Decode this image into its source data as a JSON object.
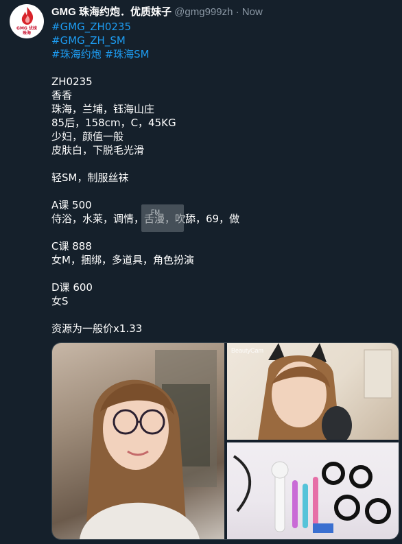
{
  "tweet": {
    "display_name": "GMG 珠海约炮．优质妹子",
    "handle": "@gmg999zh",
    "separator": "·",
    "time": "Now",
    "avatar_text_line1": "GMG 优妹",
    "avatar_text_line2": "珠海",
    "hashtags_line1": "#GMG_ZH0235",
    "hashtags_line2": "#GMG_ZH_SM",
    "hashtags_line3": [
      "#珠海约炮",
      "#珠海SM"
    ],
    "lines": {
      "code": "ZH0235",
      "name": "香香",
      "location": "珠海，兰埔，钰海山庄",
      "stats": "85后，158cm，C，45KG",
      "type": "少妇，颜值一般",
      "skin": "皮肤白，下脱毛光滑",
      "style": "轻SM，制服丝袜",
      "course_a_title": "A课 500",
      "course_a_detail": "侍浴，水莱，调情，舌漫，吹舔，69，做",
      "course_c_title": "C课 888",
      "course_c_detail": "女M，捆绑，多道具，角色扮演",
      "course_d_title": "D课 600",
      "course_d_detail": "女S",
      "note": "资源为一般价x1.33"
    },
    "overlay_label": "FM",
    "media_watermark": "BeautyCam"
  }
}
